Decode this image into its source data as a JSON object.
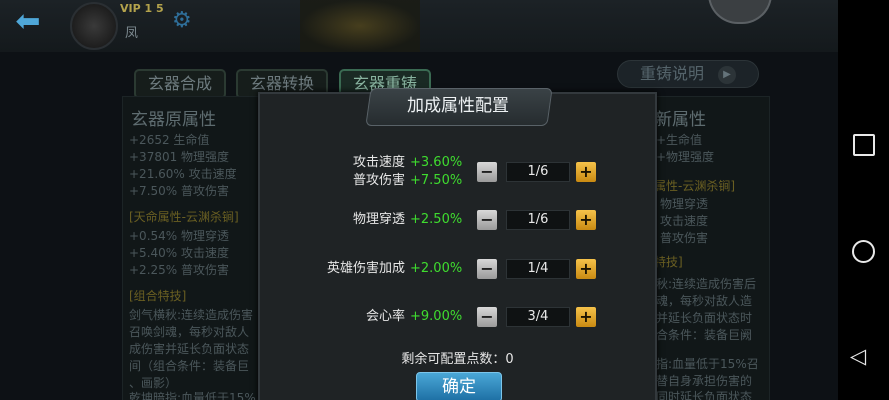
{
  "top": {
    "vip": "VIP 1 5",
    "player_name": "凤"
  },
  "tabs": [
    {
      "label": "玄器合成"
    },
    {
      "label": "玄器转换"
    },
    {
      "label": "玄器重铸"
    }
  ],
  "recast_help": "重铸说明",
  "left_panel": {
    "title": "玄器原属性",
    "base": [
      "+2652 生命值",
      "+37801 物理强度",
      "+21.60% 攻击速度",
      "+7.50% 普攻伤害"
    ],
    "heaven_title": "[天命属性-云渊杀锏]",
    "heaven": [
      "+0.54% 物理穿透",
      "+5.40% 攻击速度",
      "+2.25% 普攻伤害"
    ],
    "combo_title": "[组合特技]",
    "combo": [
      "剑气横秋:连续造成伤害",
      "召唤剑魂，每秒对敌人",
      "成伤害并延长负面状态",
      "间（组合条件：装备巨",
      "、画影）",
      "乾坤暗指:血量低于15%"
    ]
  },
  "right_panel": {
    "title": "新属性",
    "base": [
      "+生命值",
      "+物理强度"
    ],
    "heaven_title": "属性-云渊杀锏]",
    "heaven": [
      "物理穿透",
      "攻击速度",
      "普攻伤害"
    ],
    "combo_title": "特技]",
    "combo": [
      "秋:连续造成伤害后",
      "魂，每秒对敌人造",
      "并延长负面状态时",
      "合条件：装备巨阙",
      "",
      "指:血量低于15%召",
      "替自身承担伤害的",
      "同时延长负面状态"
    ]
  },
  "dialog": {
    "title": "加成属性配置",
    "rows": [
      {
        "label1": "攻击速度",
        "value1": "+3.60%",
        "label2": "普攻伤害",
        "value2": "+7.50%",
        "count": "1/6"
      },
      {
        "label1": "物理穿透",
        "value1": "+2.50%",
        "count": "1/6"
      },
      {
        "label1": "英雄伤害加成",
        "value1": "+2.00%",
        "count": "1/4"
      },
      {
        "label1": "会心率",
        "value1": "+9.00%",
        "count": "3/4"
      }
    ],
    "minus": "−",
    "plus": "+",
    "remaining": "剩余可配置点数：0",
    "confirm": "确定"
  },
  "icons": {
    "back": "back-arrow-icon",
    "settings": "gear-icon",
    "recents": "square-icon",
    "home": "circle-icon",
    "nav_back": "triangle-back-icon"
  },
  "colors": {
    "bonus_green": "#3fdc2f",
    "confirm_blue": "#2a86c0",
    "plus_gold": "#e8a82c"
  }
}
